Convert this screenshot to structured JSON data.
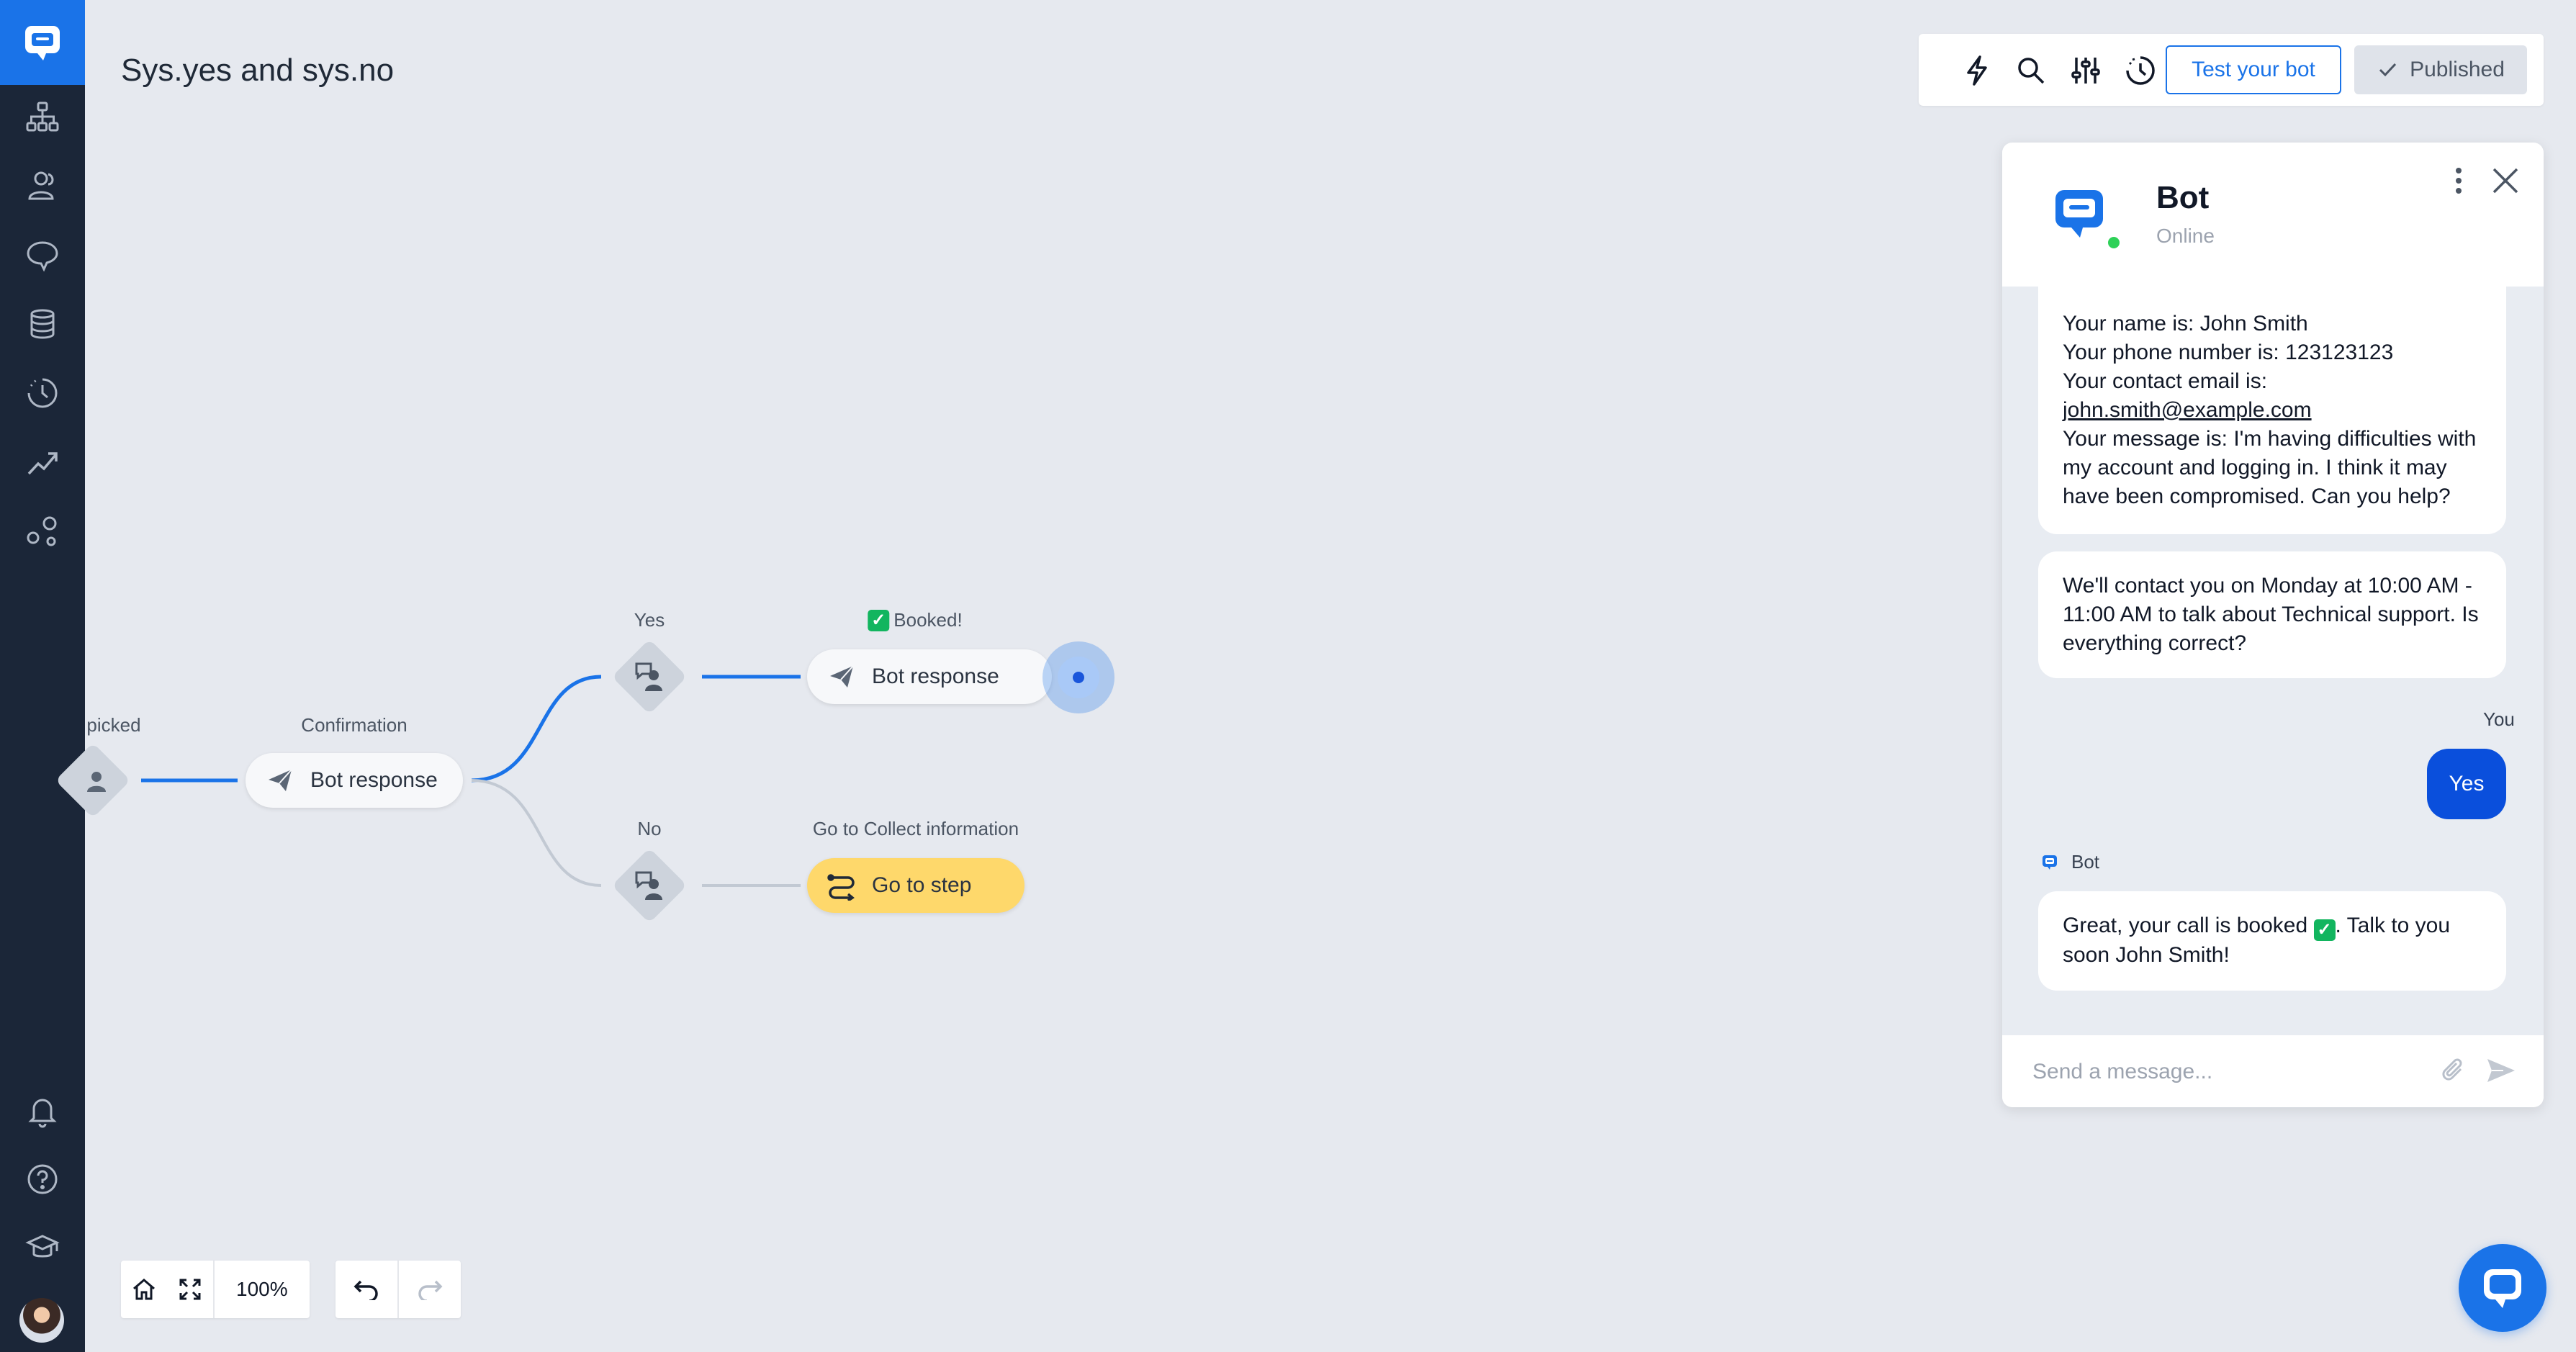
{
  "page": {
    "title": "Sys.yes and sys.no"
  },
  "sidebar": {
    "logo": "chatbot-logo-icon",
    "top_items": [
      {
        "id": "stories",
        "icon": "flow-tree-icon"
      },
      {
        "id": "audience",
        "icon": "users-icon"
      },
      {
        "id": "chats",
        "icon": "chat-bubble-icon"
      },
      {
        "id": "data",
        "icon": "database-icon"
      },
      {
        "id": "history",
        "icon": "history-icon"
      },
      {
        "id": "reports",
        "icon": "trending-up-icon"
      },
      {
        "id": "integrations",
        "icon": "integrations-icon"
      }
    ],
    "bottom_items": [
      {
        "id": "notifications",
        "icon": "bell-icon"
      },
      {
        "id": "help",
        "icon": "help-icon"
      },
      {
        "id": "academy",
        "icon": "graduation-cap-icon"
      }
    ]
  },
  "toolbar": {
    "icons": [
      "lightning-icon",
      "search-icon",
      "sliders-icon",
      "history-icon"
    ],
    "test_label": "Test your bot",
    "published_label": "Published"
  },
  "flow": {
    "nodes": [
      {
        "id": "picked",
        "kind": "user-input",
        "label": "picked"
      },
      {
        "id": "confirmation",
        "kind": "bot-response",
        "label": "Confirmation",
        "text": "Bot response"
      },
      {
        "id": "yes",
        "kind": "user-input",
        "label": "Yes"
      },
      {
        "id": "booked",
        "kind": "bot-response",
        "label": "Booked!",
        "text": "Bot response"
      },
      {
        "id": "no",
        "kind": "user-input",
        "label": "No"
      },
      {
        "id": "goto",
        "kind": "go-to-step",
        "label": "Go to Collect information",
        "text": "Go to step"
      }
    ],
    "accent": "#1a73e8",
    "inactive_edge": "#c2c9d3",
    "goto_color": "#fed86b"
  },
  "chat": {
    "bot_name": "Bot",
    "status": "Online",
    "status_color": "#2ed158",
    "messages": [
      {
        "from": "bot",
        "lines": [
          "Your name is: John Smith",
          "Your phone number is: 123123123",
          "Your contact email is:",
          "john.smith@example.com",
          "Your message is: I'm having difficulties with",
          "my account and logging in. I think it may",
          "have been compromised. Can you help?"
        ]
      },
      {
        "from": "bot",
        "lines": [
          "We'll contact you on Monday at 10:00 AM -",
          "11:00 AM to talk about Technical support. Is",
          "everything correct?"
        ]
      },
      {
        "from": "user",
        "sender_label": "You",
        "text": "Yes"
      },
      {
        "from": "bot",
        "sender_label": "Bot",
        "text_before": "Great, your call is booked",
        "text_after": ". Talk to you",
        "line2": "soon John Smith!"
      }
    ],
    "user_bubble_color": "#0a4fdc",
    "input_placeholder": "Send a message..."
  },
  "bottom_controls": {
    "zoom": "100%",
    "icons": [
      "home-icon",
      "fullscreen-icon",
      "undo-icon",
      "redo-icon"
    ]
  },
  "fab": {
    "icon": "chat-widget-icon"
  }
}
